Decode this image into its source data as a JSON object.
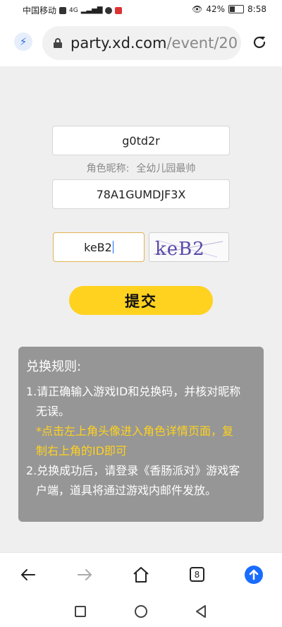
{
  "status_bar": {
    "carrier": "中国移动",
    "network": "4G",
    "battery": "42%",
    "battery_level": 0.42,
    "time": "8:58"
  },
  "browser": {
    "url_host": "party.xd.com",
    "url_path": "/event/20",
    "icons": [
      "lightning-icon",
      "lock-icon",
      "reload-icon"
    ]
  },
  "form": {
    "game_id_value": "g0td2r",
    "nickname_label": "角色昵称:",
    "nickname_value": "全幼儿园最帅",
    "redeem_code_value": "78A1GUMDJF3X",
    "captcha_input_value": "keB2",
    "captcha_image_text": "keB2",
    "submit_label": "提交"
  },
  "rules": {
    "title": "兑换规则:",
    "rule1_line1": "1.请正确输入游戏ID和兑换码，并核对昵称",
    "rule1_line2": "无误。",
    "note_line1": "*点击左上角头像进入角色详情页面，复",
    "note_line2": "制右上角的ID即可",
    "rule2_line1": "2.兑换成功后，请登录《香肠派对》游戏客",
    "rule2_line2": "户端，道具将通过游戏内邮件发放。",
    "note_color": "#ffd21f"
  },
  "toolbar": {
    "tab_count": "8"
  },
  "colors": {
    "accent_yellow": "#ffd21f",
    "accent_blue": "#1a6cff",
    "panel_gray": "#969696"
  }
}
